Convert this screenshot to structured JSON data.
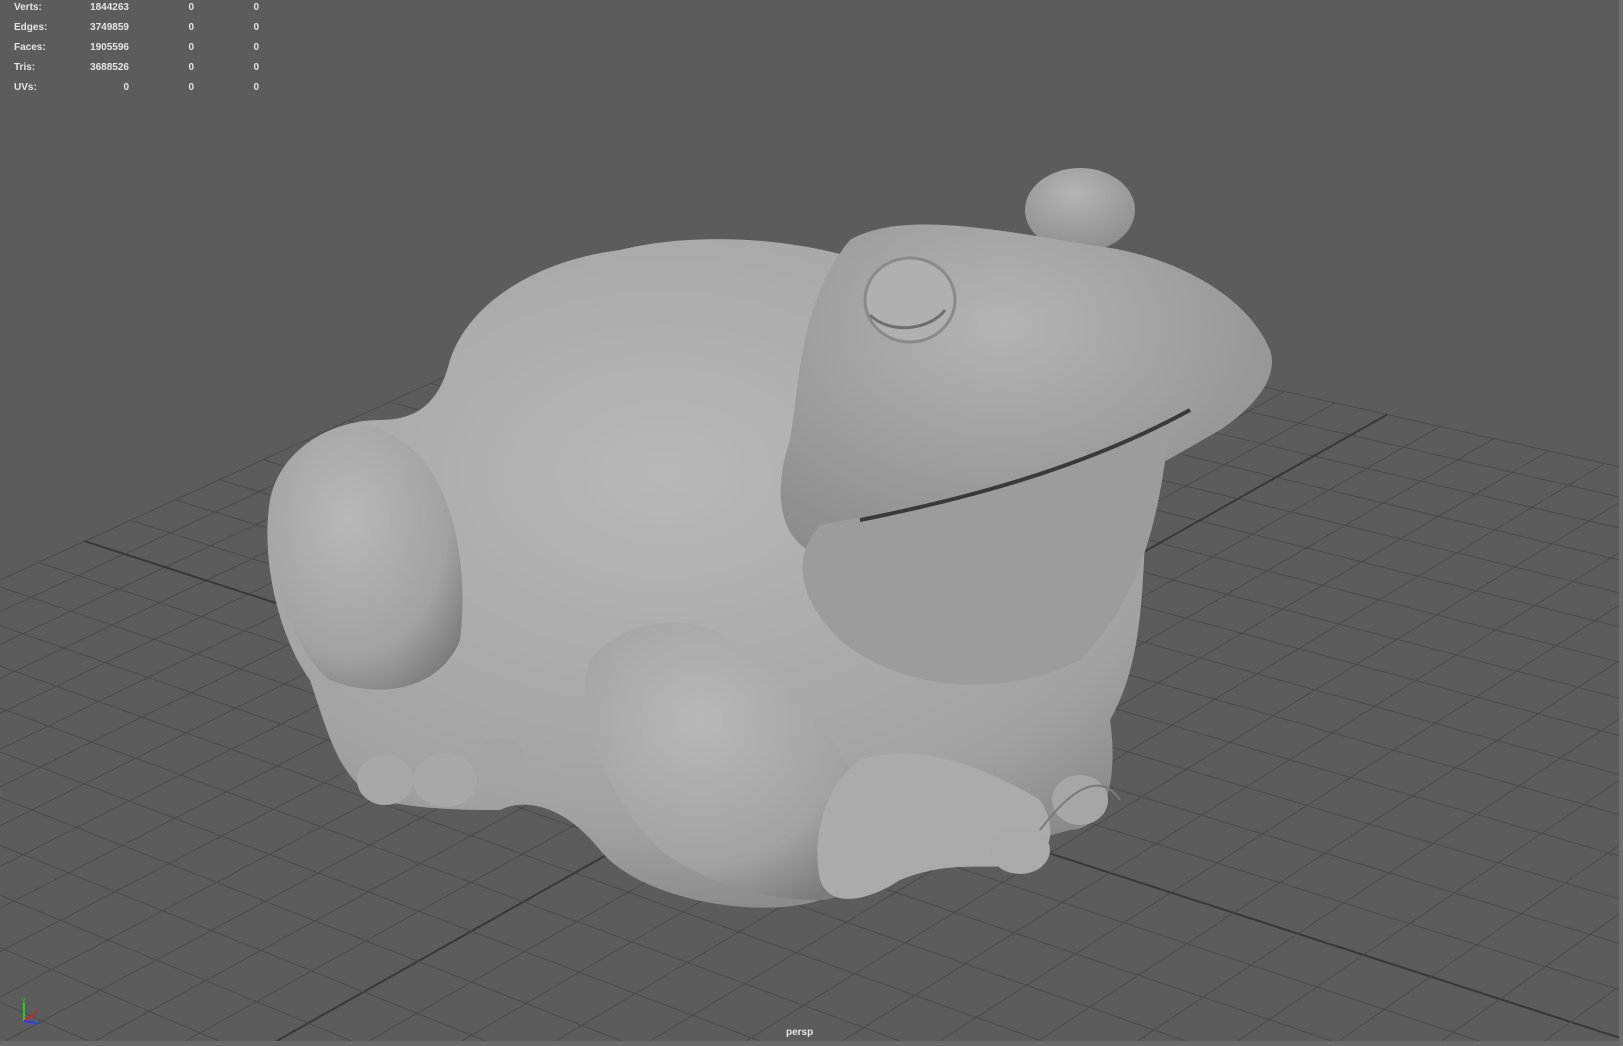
{
  "hud": {
    "rows": [
      {
        "label": "Verts:",
        "total": "1844263",
        "selected": "0",
        "component": "0"
      },
      {
        "label": "Edges:",
        "total": "3749859",
        "selected": "0",
        "component": "0"
      },
      {
        "label": "Faces:",
        "total": "1905596",
        "selected": "0",
        "component": "0"
      },
      {
        "label": "Tris:",
        "total": "3688526",
        "selected": "0",
        "component": "0"
      },
      {
        "label": "UVs:",
        "total": "0",
        "selected": "0",
        "component": "0"
      }
    ]
  },
  "camera_label": "persp",
  "axis_labels": {
    "x": "x",
    "y": "y",
    "z": "z"
  },
  "colors": {
    "background": "#5c5c5c",
    "grid": "#4a4a4a",
    "model": "#a9a9a9",
    "axis_x": "#e02020",
    "axis_y": "#20d020",
    "axis_z": "#2040ff"
  }
}
